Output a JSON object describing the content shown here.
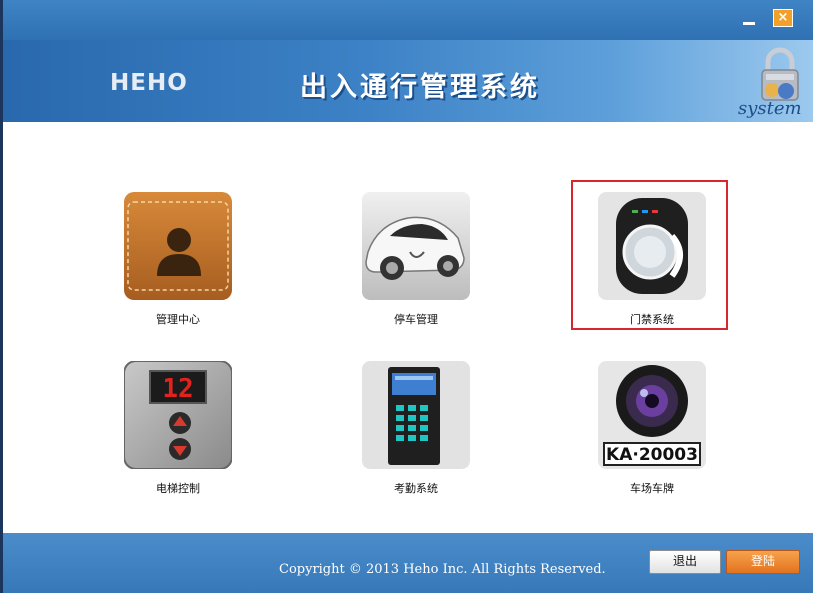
{
  "titlebar": {
    "minimize_symbol": "",
    "close_symbol": "×"
  },
  "header": {
    "logo": "HEHO",
    "title": "出入通行管理系统",
    "badge_text": "system"
  },
  "tiles": [
    {
      "label": "管理中心",
      "icon": "person-wallet-icon"
    },
    {
      "label": "停车管理",
      "icon": "sports-car-icon"
    },
    {
      "label": "门禁系统",
      "icon": "access-reader-icon",
      "selected": true
    },
    {
      "label": "电梯控制",
      "icon": "elevator-panel-icon",
      "display": "12"
    },
    {
      "label": "考勤系统",
      "icon": "attendance-terminal-icon"
    },
    {
      "label": "车场车牌",
      "icon": "plate-camera-icon",
      "plate": "KA·20003"
    }
  ],
  "footer": {
    "copyright": "Copyright ©  2013  Heho Inc.  All Rights Reserved.",
    "exit_label": "退出",
    "login_label": "登陆"
  },
  "colors": {
    "accent": "#2f71b3",
    "selection": "#d7262c",
    "login": "#e8822a"
  }
}
